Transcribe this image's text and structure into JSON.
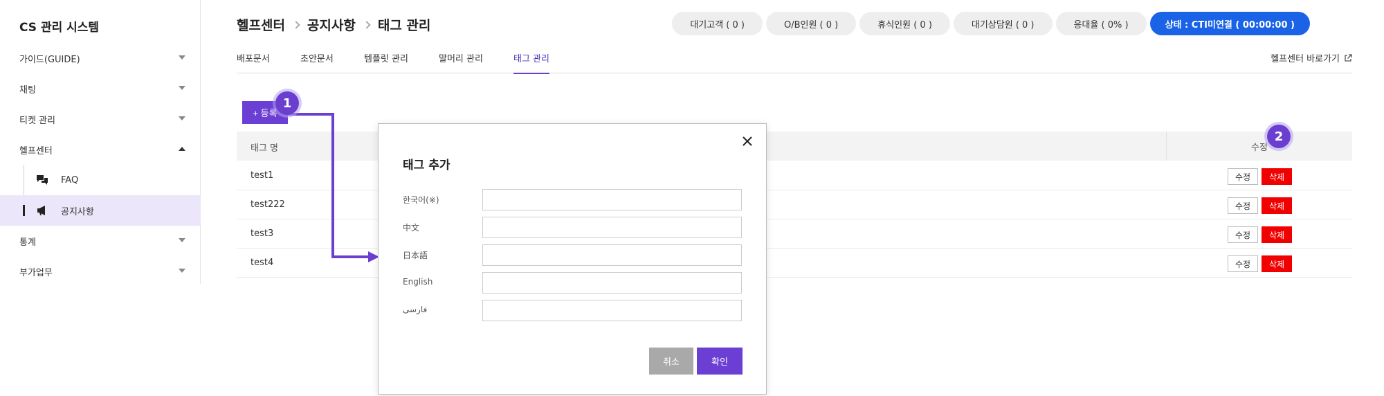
{
  "sidebar": {
    "brand": "CS 관리 시스템",
    "items": [
      {
        "label": "가이드(GUIDE)"
      },
      {
        "label": "채팅"
      },
      {
        "label": "티켓 관리"
      },
      {
        "label": "헬프센터"
      },
      {
        "label": "통계"
      },
      {
        "label": "부가업무"
      }
    ],
    "sub_items": [
      {
        "label": "FAQ",
        "icon": "chat-bubbles-icon"
      },
      {
        "label": "공지사항",
        "icon": "megaphone-icon"
      }
    ]
  },
  "header": {
    "breadcrumb": [
      "헬프센터",
      "공지사항",
      "태그 관리"
    ],
    "status": [
      {
        "label": "대기고객 ( 0 )"
      },
      {
        "label": "O/B인원 ( 0 )"
      },
      {
        "label": "휴식인원 ( 0 )"
      },
      {
        "label": "대기상담원 ( 0 )"
      },
      {
        "label": "응대율 ( 0% )"
      },
      {
        "label": "상태 : CTI미연결 ( 00:00:00 )"
      }
    ]
  },
  "tabs": [
    {
      "label": "배포문서"
    },
    {
      "label": "초안문서"
    },
    {
      "label": "템플릿 관리"
    },
    {
      "label": "말머리 관리"
    },
    {
      "label": "태그 관리"
    }
  ],
  "help_link": "헬프센터 바로가기",
  "toolbar": {
    "add_label": "+ 등록"
  },
  "table": {
    "col_name": "태그 명",
    "col_edit": "수정",
    "edit_label": "수정",
    "delete_label": "삭제",
    "rows": [
      {
        "name": "test1"
      },
      {
        "name": "test222"
      },
      {
        "name": "test3"
      },
      {
        "name": "test4"
      }
    ]
  },
  "badges": [
    "1",
    "2"
  ],
  "modal": {
    "title": "태그 추가",
    "fields": [
      {
        "label": "한국어(※)",
        "value": ""
      },
      {
        "label": "中文",
        "value": ""
      },
      {
        "label": "日本語",
        "value": ""
      },
      {
        "label": "English",
        "value": ""
      },
      {
        "label": "فارسی",
        "value": ""
      }
    ],
    "cancel_label": "취소",
    "ok_label": "확인"
  },
  "colors": {
    "accent": "#6b3fd3",
    "danger": "#f00000",
    "primary_pill": "#1a63e6"
  }
}
